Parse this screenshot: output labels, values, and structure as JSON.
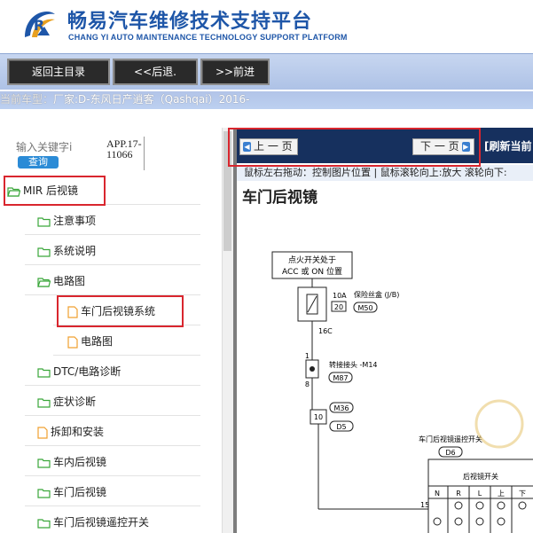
{
  "header": {
    "title": "畅易汽车维修技术支持平台",
    "subtitle": "CHANG YI AUTO MAINTENANCE TECHNOLOGY SUPPORT PLATFORM"
  },
  "toolbar": {
    "home_label": "返回主目录",
    "back_label": "<<后退.",
    "forward_label": ">>前进"
  },
  "model_bar": {
    "label": "当前车型：",
    "value": "厂家:D-东风日产逍客（Qashqai）2016-"
  },
  "search": {
    "placeholder": "输入关键字i",
    "button_label": "查询",
    "app_code": "APP.17-11066",
    "app_line1": "APP.17-",
    "app_line2": "11066"
  },
  "tree": {
    "items": [
      {
        "label": "MIR 后视镜",
        "icon": "folder-open-icon"
      },
      {
        "label": "注意事项",
        "icon": "folder-icon"
      },
      {
        "label": "系统说明",
        "icon": "folder-icon"
      },
      {
        "label": "电路图",
        "icon": "folder-open-icon"
      },
      {
        "label": "车门后视镜系统",
        "icon": "document-icon"
      },
      {
        "label": "电路图",
        "icon": "document-icon"
      },
      {
        "label": "DTC/电路诊断",
        "icon": "folder-icon"
      },
      {
        "label": "症状诊断",
        "icon": "folder-icon"
      },
      {
        "label": "拆卸和安装",
        "icon": "document-icon"
      },
      {
        "label": "车内后视镜",
        "icon": "folder-icon"
      },
      {
        "label": "车门后视镜",
        "icon": "folder-icon"
      },
      {
        "label": "车门后视镜遥控开关",
        "icon": "folder-icon"
      }
    ]
  },
  "content": {
    "prev_label": "上 一 页",
    "next_label": "下 一 页",
    "refresh_label": "[刷新当前",
    "hint": "鼠标左右拖动：控制图片位置 | 鼠标滚轮向上:放大   滚轮向下:",
    "doc_title": "车门后视镜"
  },
  "diagram": {
    "ignition_label_1": "点火开关处于",
    "ignition_label_2": "ACC 或 ON 位置",
    "fuse_amp": "10A",
    "fuse_num": "20",
    "fuse_box_label": "保险丝盒 (J/B)",
    "fuse_connector": "M50",
    "wire_16c": "16C",
    "junction_pin_top": "1",
    "junction_pin_bottom": "8",
    "junction_label": "转接接头 -M14",
    "junction_connector": "M87",
    "pin_10": "10",
    "connector_m36": "M36",
    "connector_d5": "D5",
    "switch_label": "车门后视镜遥控开关",
    "switch_connector": "D6",
    "switch_sub": "后视镜开关",
    "pin_15": "15",
    "switch_cols": [
      "N",
      "R",
      "L",
      "上",
      "下"
    ]
  },
  "colors": {
    "brand_blue": "#1e56a8",
    "toolbar_bg": "#b5c7ea",
    "navbar_bg": "#16305e",
    "highlight_red": "#d9262e",
    "folder_green": "#3aa63a",
    "doc_orange": "#f0a030"
  }
}
